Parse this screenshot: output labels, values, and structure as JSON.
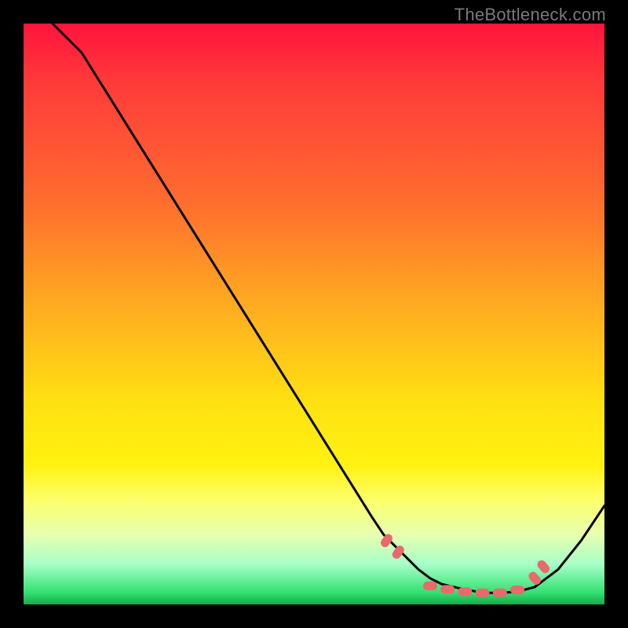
{
  "watermark": "TheBottleneck.com",
  "colors": {
    "curve": "#000000",
    "marker": "#e86a6a"
  },
  "chart_data": {
    "type": "line",
    "title": "",
    "xlabel": "",
    "ylabel": "",
    "xlim": [
      0,
      100
    ],
    "ylim": [
      0,
      100
    ],
    "grid": false,
    "series": [
      {
        "name": "bottleneck-curve",
        "x": [
          5,
          10,
          15,
          20,
          25,
          30,
          35,
          40,
          45,
          50,
          55,
          60,
          62,
          65,
          68,
          70,
          72,
          75,
          78,
          80,
          82,
          85,
          88,
          92,
          96,
          100
        ],
        "y": [
          100,
          95,
          87,
          79,
          71,
          63,
          55,
          47,
          39,
          31,
          23,
          15,
          12,
          9,
          6,
          4.5,
          3.5,
          2.8,
          2.2,
          2,
          2,
          2.2,
          3,
          6,
          11,
          17
        ]
      }
    ],
    "markers": {
      "name": "highlight-points",
      "x": [
        62.5,
        64.5,
        70,
        73,
        76,
        79,
        82,
        85,
        88,
        89.5
      ],
      "y": [
        11,
        9,
        3.2,
        2.6,
        2.2,
        2.0,
        2.0,
        2.5,
        4.5,
        6.5
      ]
    }
  }
}
